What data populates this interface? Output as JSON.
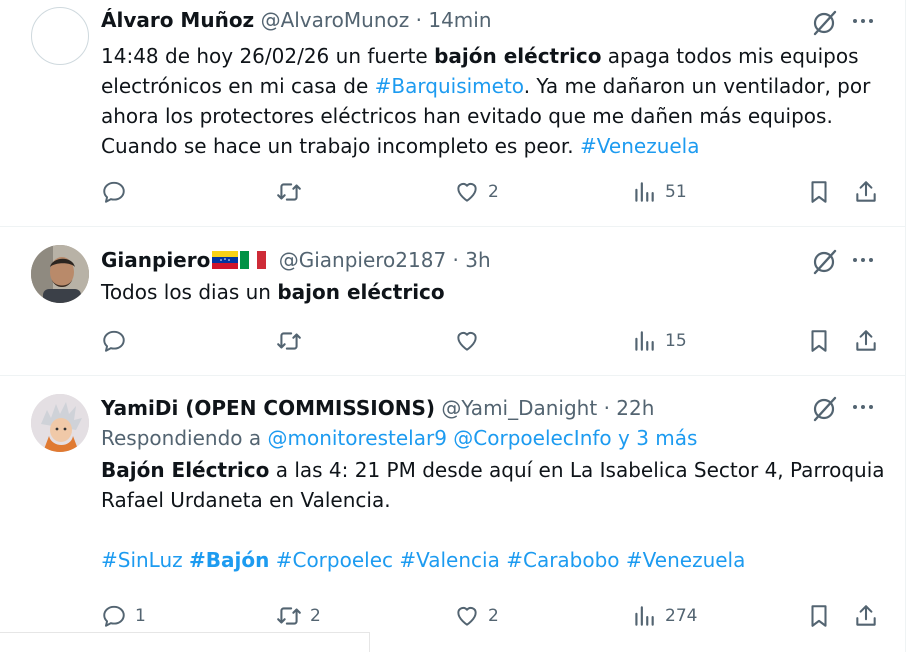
{
  "tweets": [
    {
      "name": "Álvaro Muñoz",
      "handle": "@AlvaroMunoz",
      "sep": "·",
      "time": "14min",
      "body": [
        {
          "t": "14:48 de hoy 26/02/26 un fuerte ",
          "s": "n"
        },
        {
          "t": "bajón eléctrico",
          "s": "b"
        },
        {
          "t": " apaga todos mis equipos electrónicos en mi casa de ",
          "s": "n"
        },
        {
          "t": "#Barquisimeto",
          "s": "tag"
        },
        {
          "t": ". Ya me dañaron un ventilador, por ahora los protectores eléctricos han evitado que me dañen más equipos. Cuando se hace un trabajo incompleto es peor. ",
          "s": "n"
        },
        {
          "t": "#Venezuela",
          "s": "tag"
        }
      ],
      "reply_count": "",
      "retweet_count": "",
      "like_count": "2",
      "view_count": "51"
    },
    {
      "name": "Gianpiero",
      "flags": [
        "venezuela-flag-icon",
        "italy-flag-icon"
      ],
      "handle": "@Gianpiero2187",
      "sep": "·",
      "time": "3h",
      "body": [
        {
          "t": "Todos los dias un ",
          "s": "n"
        },
        {
          "t": "bajon eléctrico",
          "s": "b"
        }
      ],
      "reply_count": "",
      "retweet_count": "",
      "like_count": "",
      "view_count": "15"
    },
    {
      "name": "YamiDi (OPEN COMMISSIONS)",
      "handle": "@Yami_Danight",
      "sep": "·",
      "time": "22h",
      "reply_prefix": "Respondiendo a ",
      "reply_to_1": "@monitorestelar9",
      "reply_to_2": "@CorpoelecInfo",
      "reply_suffix": "y 3 más",
      "body": [
        {
          "t": "Bajón Eléctrico",
          "s": "b"
        },
        {
          "t": " a las 4: 21 PM desde aquí en La Isabelica Sector 4, Parroquia Rafael Urdaneta en Valencia.",
          "s": "n"
        }
      ],
      "hashtags": [
        {
          "t": "#SinLuz",
          "s": "tag"
        },
        {
          "t": "#Bajón",
          "s": "tag-b"
        },
        {
          "t": "#Corpoelec",
          "s": "tag"
        },
        {
          "t": "#Valencia",
          "s": "tag"
        },
        {
          "t": "#Carabobo",
          "s": "tag"
        },
        {
          "t": "#Venezuela",
          "s": "tag"
        }
      ],
      "reply_count": "1",
      "retweet_count": "2",
      "like_count": "2",
      "view_count": "274"
    }
  ],
  "colors": {
    "text": "#0f1419",
    "muted": "#536471",
    "link": "#1d9bf0",
    "border": "#eff3f4"
  },
  "icons": [
    "reply-icon",
    "retweet-icon",
    "like-icon",
    "views-icon",
    "bookmark-icon",
    "share-icon",
    "grok-icon",
    "more-icon"
  ]
}
